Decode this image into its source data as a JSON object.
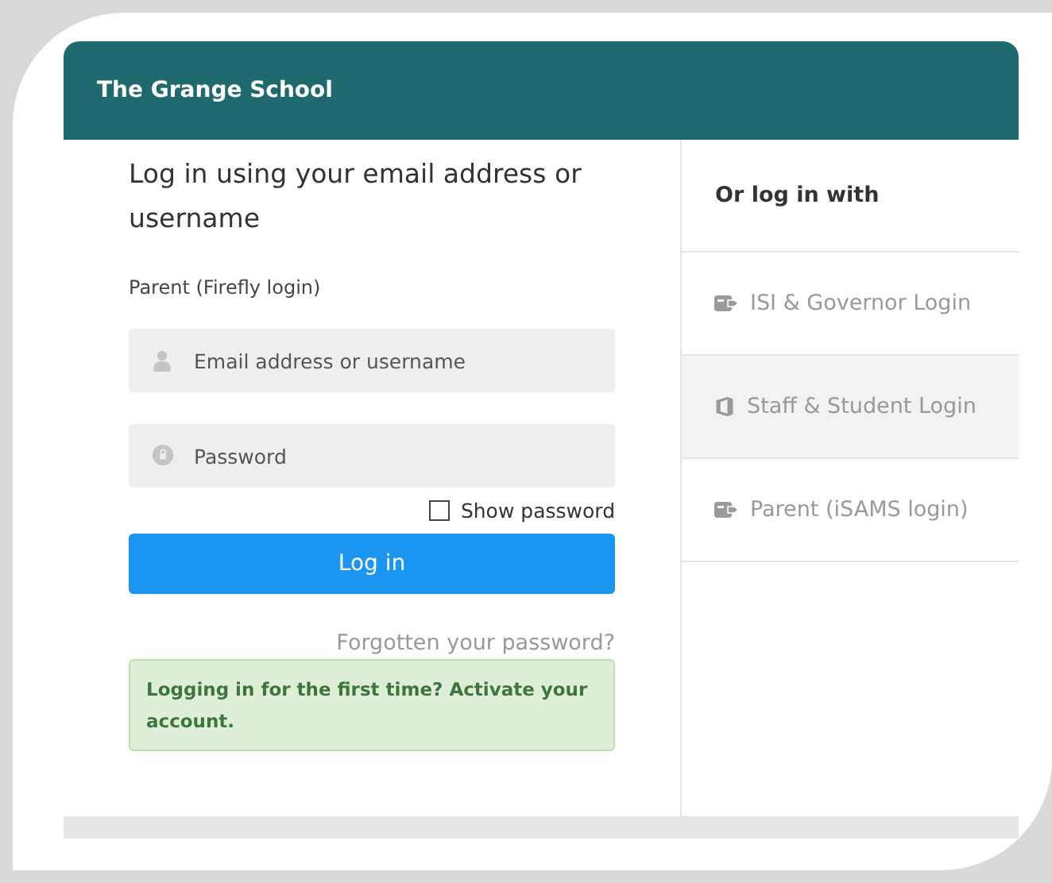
{
  "header": {
    "title": "The Grange School"
  },
  "login": {
    "heading": "Log in using your email address or username",
    "subheading": "Parent (Firefly login)",
    "fields": [
      {
        "kind": "user",
        "placeholder": "Email address or username"
      },
      {
        "kind": "password",
        "placeholder": "Password"
      }
    ],
    "show_password": {
      "label": "Show password",
      "checked": false
    },
    "submit": "Log in",
    "forgot_link": "Forgotten your password?",
    "notice": "Logging in for the first time? Activate your account."
  },
  "providers": {
    "heading": "Or log in with",
    "items": [
      {
        "kind": "card",
        "label": "ISI & Governor Login",
        "selected": false
      },
      {
        "kind": "office",
        "label": "Staff & Student Login",
        "selected": true
      },
      {
        "kind": "card",
        "label": "Parent (iSAMS login)",
        "selected": false
      }
    ]
  }
}
